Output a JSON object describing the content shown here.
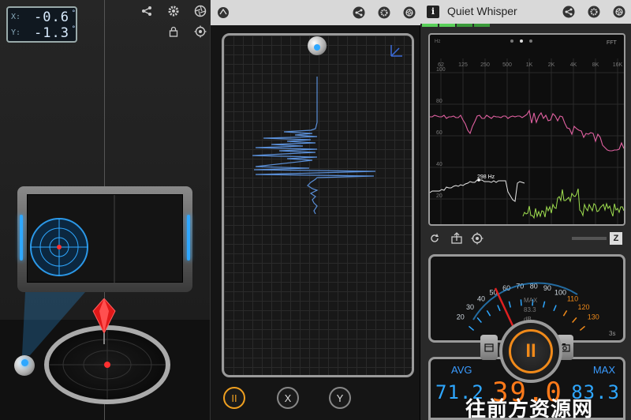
{
  "level": {
    "x_label": "X:",
    "x_value": "-0.6",
    "y_label": "Y:",
    "y_value": "-1.3",
    "degree_symbol": "°",
    "icons": [
      "share-icon",
      "gear-icon",
      "aperture-icon",
      "lock-icon",
      "target-icon"
    ],
    "accent_color": "#2ea7ff"
  },
  "seismo": {
    "icons": [
      "seismograph-logo-icon",
      "share-icon",
      "gear-icon",
      "aperture-icon"
    ],
    "buttons": {
      "pause": "II",
      "x": "X",
      "y": "Y"
    },
    "trace_color": "#5a8fd8"
  },
  "whisper": {
    "title": "Quiet Whisper",
    "info": "i",
    "spectrum": {
      "freq_ticks": [
        "62",
        "125",
        "250",
        "500",
        "1K",
        "2K",
        "4K",
        "8K",
        "16K"
      ],
      "db_ticks": [
        "100",
        "80",
        "60",
        "40",
        "20"
      ],
      "corner_left": "Hz",
      "corner_right": "FFT",
      "marker": "298 Hz",
      "peak_color": "#e060a0",
      "live_color": "#a0e050"
    },
    "tools": [
      "rotate-icon",
      "share-icon",
      "target-icon",
      "z-icon"
    ],
    "z_label": "Z",
    "meter": {
      "scale": [
        "20",
        "30",
        "40",
        "50",
        "60",
        "70",
        "80",
        "90",
        "100",
        "110",
        "120",
        "130"
      ],
      "unit": "dB",
      "max_label": "MAX",
      "max_value": "83.3",
      "time_label": "3s"
    },
    "readout": {
      "avg_label": "AVG",
      "avg_value": "71.2",
      "max_label": "MAX",
      "max_value": "83.3",
      "current_value": "39.0"
    },
    "pause_label": "II"
  },
  "watermark": "往前方资源网"
}
